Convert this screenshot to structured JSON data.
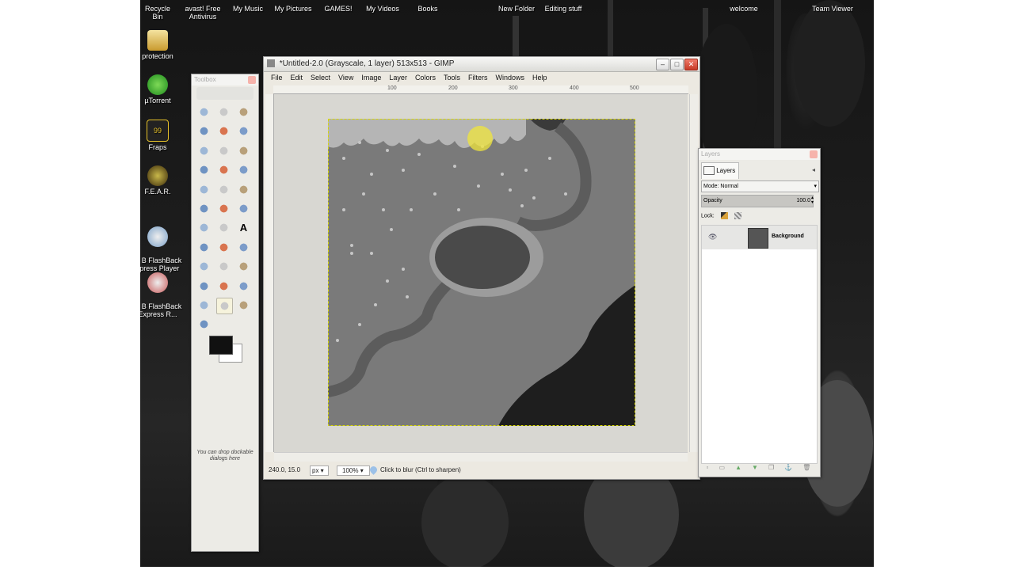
{
  "desktop": {
    "top_labels": [
      {
        "text": "Recycle Bin"
      },
      {
        "text": "avast! Free\nAntivirus"
      },
      {
        "text": "My Music"
      },
      {
        "text": "My Pictures"
      },
      {
        "text": "GAMES!"
      },
      {
        "text": "My Videos"
      },
      {
        "text": "Books"
      },
      {
        "text": "New Folder"
      },
      {
        "text": "Editing stuff"
      },
      {
        "text": "welcome"
      },
      {
        "text": "Team Viewer"
      }
    ],
    "side_icons": [
      {
        "label": "protection",
        "icon": "protection-folder-icon"
      },
      {
        "label": "µTorrent",
        "icon": "utorrent-icon"
      },
      {
        "label": "Fraps",
        "icon": "fraps-icon"
      },
      {
        "label": "F.E.A.R.",
        "icon": "fear-game-icon"
      },
      {
        "label": "B FlashBack\nxpress Player",
        "icon": "flashback-player-icon"
      },
      {
        "label": "B FlashBack\nExpress R...",
        "icon": "flashback-recorder-icon"
      }
    ]
  },
  "toolbox": {
    "title": "Toolbox",
    "hint": "You can drop dockable dialogs here"
  },
  "gimp": {
    "title": "*Untitled-2.0 (Grayscale, 1 layer) 513x513 - GIMP",
    "menu": [
      "File",
      "Edit",
      "Select",
      "View",
      "Image",
      "Layer",
      "Colors",
      "Tools",
      "Filters",
      "Windows",
      "Help"
    ],
    "ruler_h": [
      "100",
      "200",
      "300",
      "400",
      "500"
    ],
    "status": {
      "coords": "240.0, 15.0",
      "unit": "px",
      "zoom": "100%",
      "message": "Click to blur (Ctrl to sharpen)"
    }
  },
  "layers": {
    "title": "Layers",
    "tab": "Layers",
    "mode_label": "Mode: Normal",
    "opacity_label": "Opacity",
    "opacity_value": "100.0",
    "lock_label": "Lock:",
    "layer_name": "Background"
  }
}
